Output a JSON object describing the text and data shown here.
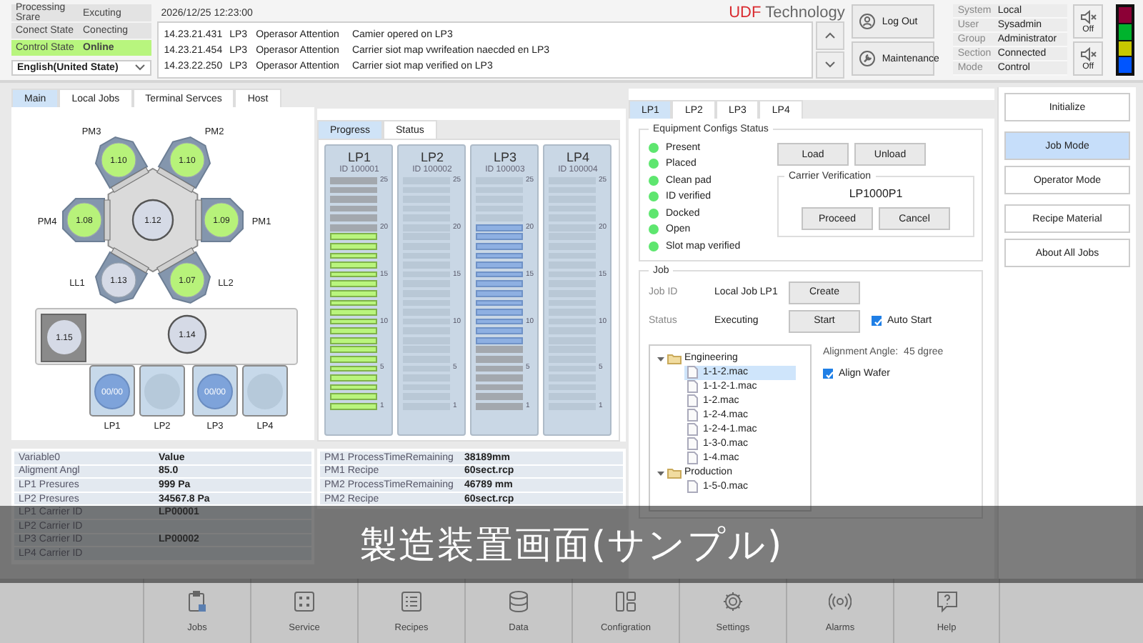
{
  "status_panel": {
    "rows": [
      {
        "label": "Processing Srare",
        "value": "Excuting",
        "highlighted": false
      },
      {
        "label": "Conect State",
        "value": "Conecting",
        "highlighted": false
      },
      {
        "label": "Control State",
        "value": "Online",
        "highlighted": true
      }
    ],
    "language": "English(United State)"
  },
  "datetime": "2026/12/25  12:23:00",
  "brand": {
    "mark": "UDF",
    "name": "Technology"
  },
  "log": [
    {
      "time": "14.23.21.431",
      "port": "LP3",
      "type": "Operasor Attention",
      "message": "Camier opered on LP3"
    },
    {
      "time": "14.23.21.454",
      "port": "LP3",
      "type": "Operasor Attention",
      "message": "Carrier siot map vwrifeation naecded en LP3"
    },
    {
      "time": "14.23.22.250",
      "port": "LP3",
      "type": "Operasor Attention",
      "message": "Carrier siot map verified on LP3"
    }
  ],
  "account_buttons": [
    "Log Out",
    "Maintenance"
  ],
  "system_info": [
    {
      "label": "System",
      "value": "Local"
    },
    {
      "label": "User",
      "value": "Sysadmin"
    },
    {
      "label": "Group",
      "value": "Administrator"
    },
    {
      "label": "Section",
      "value": "Connected"
    },
    {
      "label": "Mode",
      "value": "Control"
    }
  ],
  "sound_buttons": [
    "Off",
    "Off"
  ],
  "signal_tower": [
    {
      "color": "#8c0036"
    },
    {
      "color": "#00b32d"
    },
    {
      "color": "#c8c800"
    },
    {
      "color": "#0055ff"
    }
  ],
  "main_tabs": [
    {
      "label": "Main",
      "selected": true
    },
    {
      "label": "Local Jobs",
      "selected": false
    },
    {
      "label": "Terminal Servces",
      "selected": false
    },
    {
      "label": "Host",
      "selected": false
    }
  ],
  "diagram": {
    "chambers": [
      {
        "label": "PM3",
        "value": "1.10",
        "active": true
      },
      {
        "label": "PM2",
        "value": "1.10",
        "active": true
      },
      {
        "label": "PM4",
        "value": "1.08",
        "active": true
      },
      {
        "label": "PM1",
        "value": "1.09",
        "active": true
      },
      {
        "label": "LL1",
        "value": "1.13",
        "active": false
      },
      {
        "label": "LL2",
        "value": "1.07",
        "active": true
      }
    ],
    "center": {
      "value": "1.12"
    },
    "aligner": {
      "value": "1.15"
    },
    "robot": {
      "value": "1.14"
    },
    "load_ports": [
      {
        "label": "LP1",
        "value": "00/00",
        "loaded": true
      },
      {
        "label": "LP2",
        "loaded": false
      },
      {
        "label": "LP3",
        "value": "00/00",
        "loaded": true
      },
      {
        "label": "LP4",
        "loaded": false
      }
    ]
  },
  "progress_tabs": [
    {
      "label": "Progress",
      "selected": true
    },
    {
      "label": "Status",
      "selected": false
    }
  ],
  "carriers": [
    {
      "name": "LP1",
      "id": "ID 100001",
      "ticks": [
        "25",
        "20",
        "15",
        "10",
        "5",
        "1"
      ],
      "slots": [
        {
          "kind": "done"
        },
        {
          "kind": "done"
        },
        {
          "kind": "done"
        },
        {
          "kind": "done"
        },
        {
          "kind": "done"
        },
        {
          "kind": "done"
        },
        {
          "kind": "done"
        },
        {
          "kind": "done"
        },
        {
          "kind": "done"
        },
        {
          "kind": "done"
        },
        {
          "kind": "done"
        },
        {
          "kind": "done"
        },
        {
          "kind": "done"
        },
        {
          "kind": "done"
        },
        {
          "kind": "done"
        },
        {
          "kind": "done"
        },
        {
          "kind": "done"
        },
        {
          "kind": "done"
        },
        {
          "kind": "done"
        },
        {
          "kind": "wait"
        },
        {
          "kind": "wait"
        },
        {
          "kind": "wait"
        },
        {
          "kind": "wait"
        },
        {
          "kind": "wait"
        },
        {
          "kind": "wait"
        }
      ]
    },
    {
      "name": "LP2",
      "id": "ID 100002",
      "ticks": [
        "25",
        "20",
        "15",
        "10",
        "5",
        "1"
      ],
      "slots": [
        {
          "kind": "none"
        },
        {
          "kind": "none"
        },
        {
          "kind": "none"
        },
        {
          "kind": "none"
        },
        {
          "kind": "none"
        },
        {
          "kind": "none"
        },
        {
          "kind": "none"
        },
        {
          "kind": "none"
        },
        {
          "kind": "none"
        },
        {
          "kind": "none"
        },
        {
          "kind": "none"
        },
        {
          "kind": "none"
        },
        {
          "kind": "none"
        },
        {
          "kind": "none"
        },
        {
          "kind": "none"
        },
        {
          "kind": "none"
        },
        {
          "kind": "none"
        },
        {
          "kind": "none"
        },
        {
          "kind": "none"
        },
        {
          "kind": "none"
        },
        {
          "kind": "none"
        },
        {
          "kind": "none"
        },
        {
          "kind": "none"
        },
        {
          "kind": "none"
        },
        {
          "kind": "none"
        }
      ]
    },
    {
      "name": "LP3",
      "id": "ID 100003",
      "ticks": [
        "25",
        "20",
        "15",
        "10",
        "5",
        "1"
      ],
      "slots": [
        {
          "kind": "wait"
        },
        {
          "kind": "wait"
        },
        {
          "kind": "wait"
        },
        {
          "kind": "wait"
        },
        {
          "kind": "wait"
        },
        {
          "kind": "wait"
        },
        {
          "kind": "wait"
        },
        {
          "kind": "run"
        },
        {
          "kind": "run"
        },
        {
          "kind": "run"
        },
        {
          "kind": "run"
        },
        {
          "kind": "run"
        },
        {
          "kind": "run"
        },
        {
          "kind": "run"
        },
        {
          "kind": "run"
        },
        {
          "kind": "run"
        },
        {
          "kind": "run"
        },
        {
          "kind": "run"
        },
        {
          "kind": "run"
        },
        {
          "kind": "run"
        },
        {
          "kind": "none"
        },
        {
          "kind": "none"
        },
        {
          "kind": "none"
        },
        {
          "kind": "none"
        },
        {
          "kind": "none"
        }
      ]
    },
    {
      "name": "LP4",
      "id": "ID 100004",
      "ticks": [
        "25",
        "20",
        "15",
        "10",
        "5",
        "1"
      ],
      "slots": [
        {
          "kind": "none"
        },
        {
          "kind": "none"
        },
        {
          "kind": "none"
        },
        {
          "kind": "none"
        },
        {
          "kind": "none"
        },
        {
          "kind": "none"
        },
        {
          "kind": "none"
        },
        {
          "kind": "none"
        },
        {
          "kind": "none"
        },
        {
          "kind": "none"
        },
        {
          "kind": "none"
        },
        {
          "kind": "none"
        },
        {
          "kind": "none"
        },
        {
          "kind": "none"
        },
        {
          "kind": "none"
        },
        {
          "kind": "none"
        },
        {
          "kind": "none"
        },
        {
          "kind": "none"
        },
        {
          "kind": "none"
        },
        {
          "kind": "none"
        },
        {
          "kind": "none"
        },
        {
          "kind": "none"
        },
        {
          "kind": "none"
        },
        {
          "kind": "none"
        },
        {
          "kind": "none"
        }
      ]
    }
  ],
  "lp_tabs": [
    {
      "label": "LP1",
      "selected": true
    },
    {
      "label": "LP2",
      "selected": false
    },
    {
      "label": "LP3",
      "selected": false
    },
    {
      "label": "LP4",
      "selected": false
    }
  ],
  "equipment_status": {
    "title": "Equipment Configs Status",
    "items": [
      {
        "label": "Present",
        "on": true
      },
      {
        "label": "Placed",
        "on": true
      },
      {
        "label": "Clean pad",
        "on": true
      },
      {
        "label": "ID verified",
        "on": true
      },
      {
        "label": "Docked",
        "on": true
      },
      {
        "label": "Open",
        "on": true
      },
      {
        "label": "Slot map verified",
        "on": true
      }
    ],
    "buttons": [
      "Load",
      "Unload"
    ]
  },
  "carrier_verification": {
    "title": "Carrier Verification",
    "carrier_id": "LP1000P1",
    "buttons": [
      "Proceed",
      "Cancel"
    ]
  },
  "job": {
    "title": "Job",
    "fields": [
      {
        "label": "Job ID",
        "value": "Local Job LP1",
        "button": "Create"
      },
      {
        "label": "Status",
        "value": "Executing",
        "button": "Start"
      }
    ],
    "auto_start": {
      "label": "Auto Start",
      "checked": true
    },
    "recipe_tree": [
      {
        "label": "Engineering",
        "expanded": true,
        "children": [
          {
            "label": "1-1-2.mac",
            "selected": true
          },
          {
            "label": "1-1-2-1.mac",
            "selected": false
          },
          {
            "label": "1-2.mac",
            "selected": false
          },
          {
            "label": "1-2-4.mac",
            "selected": false
          },
          {
            "label": "1-2-4-1.mac",
            "selected": false
          },
          {
            "label": "1-3-0.mac",
            "selected": false
          },
          {
            "label": "1-4.mac",
            "selected": false
          }
        ]
      },
      {
        "label": "Production",
        "expanded": true,
        "children": [
          {
            "label": "1-5-0.mac",
            "selected": false
          }
        ]
      }
    ],
    "alignment": {
      "label": "Alignment Angle:",
      "value": "45 dgree"
    },
    "align_wafer": {
      "label": "Align Wafer",
      "checked": true
    }
  },
  "mode_buttons": [
    {
      "label": "Initialize",
      "selected": false
    },
    {
      "label": "Job Mode",
      "selected": true
    },
    {
      "label": "Operator Mode",
      "selected": false
    },
    {
      "label": "Recipe Material",
      "selected": false
    },
    {
      "label": "About All Jobs",
      "selected": false
    }
  ],
  "variables": [
    {
      "name": "Variable0",
      "value": "Value"
    },
    {
      "name": "Aligment Angl",
      "value": "85.0"
    },
    {
      "name": "LP1 Presures",
      "value": "999 Pa"
    },
    {
      "name": "LP2 Presures",
      "value": "34567.8 Pa"
    },
    {
      "name": "LP1 Carrier ID",
      "value": "LP00001"
    },
    {
      "name": "LP2 Carrier ID"
    },
    {
      "name": "LP3 Carrier ID",
      "value": "LP00002"
    },
    {
      "name": "LP4 Carrier ID"
    }
  ],
  "process_info": [
    {
      "name": "PM1 ProcessTimeRemaining",
      "value": "38189mm"
    },
    {
      "name": "PM1 Recipe",
      "value": "60sect.rcp"
    },
    {
      "name": "PM2 ProcessTimeRemaining",
      "value": "46789 mm"
    },
    {
      "name": "PM2 Recipe",
      "value": "60sect.rcp"
    }
  ],
  "nav": [
    "Jobs",
    "Service",
    "Recipes",
    "Data",
    "Configration",
    "Settings",
    "Alarms",
    "Help"
  ],
  "caption": "製造装置画面(サンプル)"
}
